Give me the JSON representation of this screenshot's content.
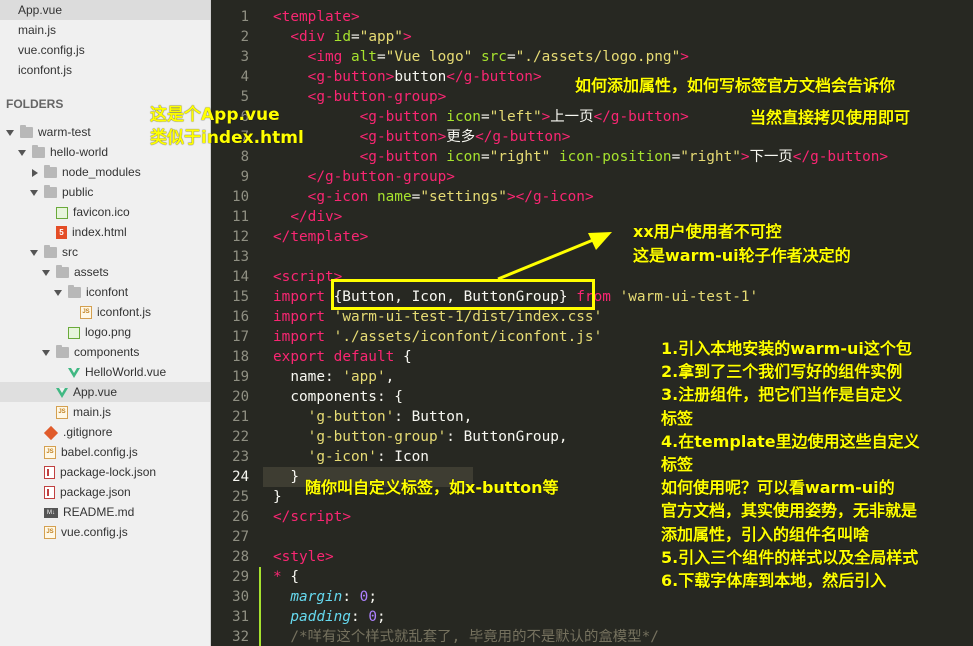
{
  "sidebar": {
    "open_files": [
      {
        "name": "App.vue",
        "active": true
      },
      {
        "name": "main.js",
        "active": false
      },
      {
        "name": "vue.config.js",
        "active": false
      },
      {
        "name": "iconfont.js",
        "active": false
      }
    ],
    "folders_title": "FOLDERS",
    "tree": [
      {
        "name": "warm-test",
        "type": "folder",
        "depth": 0,
        "open": true
      },
      {
        "name": "hello-world",
        "type": "folder",
        "depth": 1,
        "open": true
      },
      {
        "name": "node_modules",
        "type": "folder",
        "depth": 2,
        "open": false
      },
      {
        "name": "public",
        "type": "folder",
        "depth": 2,
        "open": true
      },
      {
        "name": "favicon.ico",
        "type": "image",
        "depth": 3
      },
      {
        "name": "index.html",
        "type": "html",
        "depth": 3
      },
      {
        "name": "src",
        "type": "folder",
        "depth": 2,
        "open": true
      },
      {
        "name": "assets",
        "type": "folder",
        "depth": 3,
        "open": true
      },
      {
        "name": "iconfont",
        "type": "folder",
        "depth": 4,
        "open": true
      },
      {
        "name": "iconfont.js",
        "type": "js",
        "depth": 5
      },
      {
        "name": "logo.png",
        "type": "image",
        "depth": 4
      },
      {
        "name": "components",
        "type": "folder",
        "depth": 3,
        "open": true
      },
      {
        "name": "HelloWorld.vue",
        "type": "vue",
        "depth": 4
      },
      {
        "name": "App.vue",
        "type": "vue",
        "depth": 3,
        "active": true
      },
      {
        "name": "main.js",
        "type": "js",
        "depth": 3
      },
      {
        "name": ".gitignore",
        "type": "git",
        "depth": 2
      },
      {
        "name": "babel.config.js",
        "type": "js",
        "depth": 2
      },
      {
        "name": "package-lock.json",
        "type": "json",
        "depth": 2
      },
      {
        "name": "package.json",
        "type": "json",
        "depth": 2
      },
      {
        "name": "README.md",
        "type": "md",
        "depth": 2
      },
      {
        "name": "vue.config.js",
        "type": "js",
        "depth": 2
      }
    ]
  },
  "editor": {
    "current_line": 24,
    "modified_lines": [
      29,
      30,
      31,
      32
    ],
    "lines": [
      [
        [
          "t",
          "<template>"
        ]
      ],
      [
        [
          "p",
          "  "
        ],
        [
          "t",
          "<div"
        ],
        [
          "p",
          " "
        ],
        [
          "a",
          "id"
        ],
        [
          "p",
          "="
        ],
        [
          "s",
          "\"app\""
        ],
        [
          "t",
          ">"
        ]
      ],
      [
        [
          "p",
          "    "
        ],
        [
          "t",
          "<img"
        ],
        [
          "p",
          " "
        ],
        [
          "a",
          "alt"
        ],
        [
          "p",
          "="
        ],
        [
          "s",
          "\"Vue logo\""
        ],
        [
          "p",
          " "
        ],
        [
          "a",
          "src"
        ],
        [
          "p",
          "="
        ],
        [
          "s",
          "\"./assets/logo.png\""
        ],
        [
          "t",
          ">"
        ]
      ],
      [
        [
          "p",
          "    "
        ],
        [
          "t",
          "<g-button"
        ],
        [
          "t",
          ">"
        ],
        [
          "p",
          "button"
        ],
        [
          "t",
          "</g-button"
        ],
        [
          "t",
          ">"
        ]
      ],
      [
        [
          "p",
          "    "
        ],
        [
          "t",
          "<g-button-group"
        ],
        [
          "t",
          ">"
        ]
      ],
      [
        [
          "p",
          "          "
        ],
        [
          "t",
          "<g-button"
        ],
        [
          "p",
          " "
        ],
        [
          "a",
          "icon"
        ],
        [
          "p",
          "="
        ],
        [
          "s",
          "\"left\""
        ],
        [
          "t",
          ">"
        ],
        [
          "p",
          "上一页"
        ],
        [
          "t",
          "</g-button"
        ],
        [
          "t",
          ">"
        ]
      ],
      [
        [
          "p",
          "          "
        ],
        [
          "t",
          "<g-button"
        ],
        [
          "t",
          ">"
        ],
        [
          "p",
          "更多"
        ],
        [
          "t",
          "</g-button"
        ],
        [
          "t",
          ">"
        ]
      ],
      [
        [
          "p",
          "          "
        ],
        [
          "t",
          "<g-button"
        ],
        [
          "p",
          " "
        ],
        [
          "a",
          "icon"
        ],
        [
          "p",
          "="
        ],
        [
          "s",
          "\"right\""
        ],
        [
          "p",
          " "
        ],
        [
          "a",
          "icon-position"
        ],
        [
          "p",
          "="
        ],
        [
          "s",
          "\"right\""
        ],
        [
          "t",
          ">"
        ],
        [
          "p",
          "下一页"
        ],
        [
          "t",
          "</g-button"
        ],
        [
          "t",
          ">"
        ]
      ],
      [
        [
          "p",
          "    "
        ],
        [
          "t",
          "</g-button-group"
        ],
        [
          "t",
          ">"
        ]
      ],
      [
        [
          "p",
          "    "
        ],
        [
          "t",
          "<g-icon"
        ],
        [
          "p",
          " "
        ],
        [
          "a",
          "name"
        ],
        [
          "p",
          "="
        ],
        [
          "s",
          "\"settings\""
        ],
        [
          "t",
          ">"
        ],
        [
          "t",
          "</g-icon"
        ],
        [
          "t",
          ">"
        ]
      ],
      [
        [
          "p",
          "  "
        ],
        [
          "t",
          "</div"
        ],
        [
          "t",
          ">"
        ]
      ],
      [
        [
          "t",
          "</template"
        ],
        [
          "t",
          ">"
        ]
      ],
      [
        [
          "p",
          ""
        ]
      ],
      [
        [
          "t",
          "<script"
        ],
        [
          "t",
          ">"
        ]
      ],
      [
        [
          "k",
          "import"
        ],
        [
          "p",
          " {Button, Icon, ButtonGroup} "
        ],
        [
          "k",
          "from"
        ],
        [
          "p",
          " "
        ],
        [
          "s",
          "'warm-ui-test-1'"
        ]
      ],
      [
        [
          "k",
          "import"
        ],
        [
          "p",
          " "
        ],
        [
          "s",
          "'warm-ui-test-1/dist/index.css'"
        ]
      ],
      [
        [
          "k",
          "import"
        ],
        [
          "p",
          " "
        ],
        [
          "s",
          "'./assets/iconfont/iconfont.js'"
        ]
      ],
      [
        [
          "k",
          "export"
        ],
        [
          "p",
          " "
        ],
        [
          "k",
          "default"
        ],
        [
          "p",
          " {"
        ]
      ],
      [
        [
          "p",
          "  name: "
        ],
        [
          "s",
          "'app'"
        ],
        [
          "p",
          ","
        ]
      ],
      [
        [
          "p",
          "  components: {"
        ]
      ],
      [
        [
          "p",
          "    "
        ],
        [
          "s",
          "'g-button'"
        ],
        [
          "p",
          ": Button,"
        ]
      ],
      [
        [
          "p",
          "    "
        ],
        [
          "s",
          "'g-button-group'"
        ],
        [
          "p",
          ": ButtonGroup,"
        ]
      ],
      [
        [
          "p",
          "    "
        ],
        [
          "s",
          "'g-icon'"
        ],
        [
          "p",
          ": Icon"
        ]
      ],
      [
        [
          "p",
          "  }"
        ]
      ],
      [
        [
          "p",
          "}"
        ]
      ],
      [
        [
          "t",
          "</script"
        ],
        [
          "t",
          ">"
        ]
      ],
      [
        [
          "p",
          ""
        ]
      ],
      [
        [
          "t",
          "<style"
        ],
        [
          "t",
          ">"
        ]
      ],
      [
        [
          "t",
          "*"
        ],
        [
          "p",
          " {"
        ]
      ],
      [
        [
          "p",
          "  "
        ],
        [
          "prop",
          "margin"
        ],
        [
          "p",
          ": "
        ],
        [
          "num",
          "0"
        ],
        [
          "p",
          ";"
        ]
      ],
      [
        [
          "p",
          "  "
        ],
        [
          "prop",
          "padding"
        ],
        [
          "p",
          ": "
        ],
        [
          "num",
          "0"
        ],
        [
          "p",
          ";"
        ]
      ],
      [
        [
          "p",
          "  "
        ],
        [
          "cm",
          "/*咩有这个样式就乱套了, 毕竟用的不是默认的盒模型*/"
        ]
      ]
    ]
  },
  "annotations": {
    "app_vue_note": [
      "这是个App.vue",
      "类似于index.html"
    ],
    "attr_note": "如何添加属性，如何写标签官方文档会告诉你",
    "copy_note": "当然直接拷贝使用即可",
    "uncontrollable_note": [
      "xx用户使用者不可控",
      "这是warm-ui轮子作者决定的"
    ],
    "steps_note": [
      "1.引入本地安装的warm-ui这个包",
      "2.拿到了三个我们写好的组件实例",
      "3.注册组件，把它们当作是自定义",
      "标签",
      "4.在template里边使用这些自定义",
      "标签",
      "如何使用呢？可以看warm-ui的",
      "官方文档，其实使用姿势，无非就是",
      "添加属性，引入的组件名叫啥",
      "5.引入三个组件的样式以及全局样式",
      "6.下载字体库到本地，然后引入"
    ],
    "custom_tag_note": "随你叫自定义标签，如x-button等",
    "highlight_color": "#ffff00"
  }
}
